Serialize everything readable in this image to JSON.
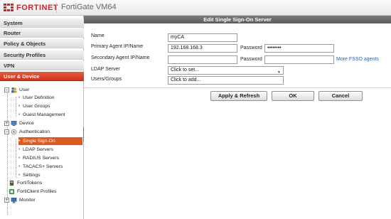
{
  "header": {
    "brand": "FORTINET",
    "product": "FortiGate VM64"
  },
  "sidebar": {
    "nav": [
      {
        "label": "System"
      },
      {
        "label": "Router"
      },
      {
        "label": "Policy & Objects"
      },
      {
        "label": "Security Profiles"
      },
      {
        "label": "VPN"
      },
      {
        "label": "User & Device"
      }
    ],
    "tree": {
      "user": "User",
      "user_definition": "User Definition",
      "user_groups": "User Groups",
      "guest_management": "Guest Management",
      "device": "Device",
      "authentication": "Authentication",
      "single_sign_on": "Single Sign-On",
      "ldap_servers": "LDAP Servers",
      "radius_servers": "RADIUS Servers",
      "tacacs_servers": "TACACS+ Servers",
      "settings": "Settings",
      "fortitokens": "FortiTokens",
      "forticlient_profiles": "FortiClient Profiles",
      "monitor": "Monitor"
    }
  },
  "panel": {
    "title": "Edit Single Sign-On Server",
    "name_label": "Name",
    "name_value": "myCA",
    "primary_label": "Primary Agent IP/Name",
    "primary_value": "192.168.168.3",
    "primary_password_label": "Password",
    "primary_password_value": "••••••••",
    "secondary_label": "Secondary Agent IP/Name",
    "secondary_value": "",
    "secondary_password_label": "Password",
    "secondary_password_value": "",
    "more_link": "More FSSO agents",
    "ldap_label": "LDAP Server",
    "ldap_value": "Click to set...",
    "users_label": "Users/Groups",
    "users_value": "Click to add...",
    "apply_button": "Apply & Refresh",
    "ok_button": "OK",
    "cancel_button": "Cancel"
  }
}
